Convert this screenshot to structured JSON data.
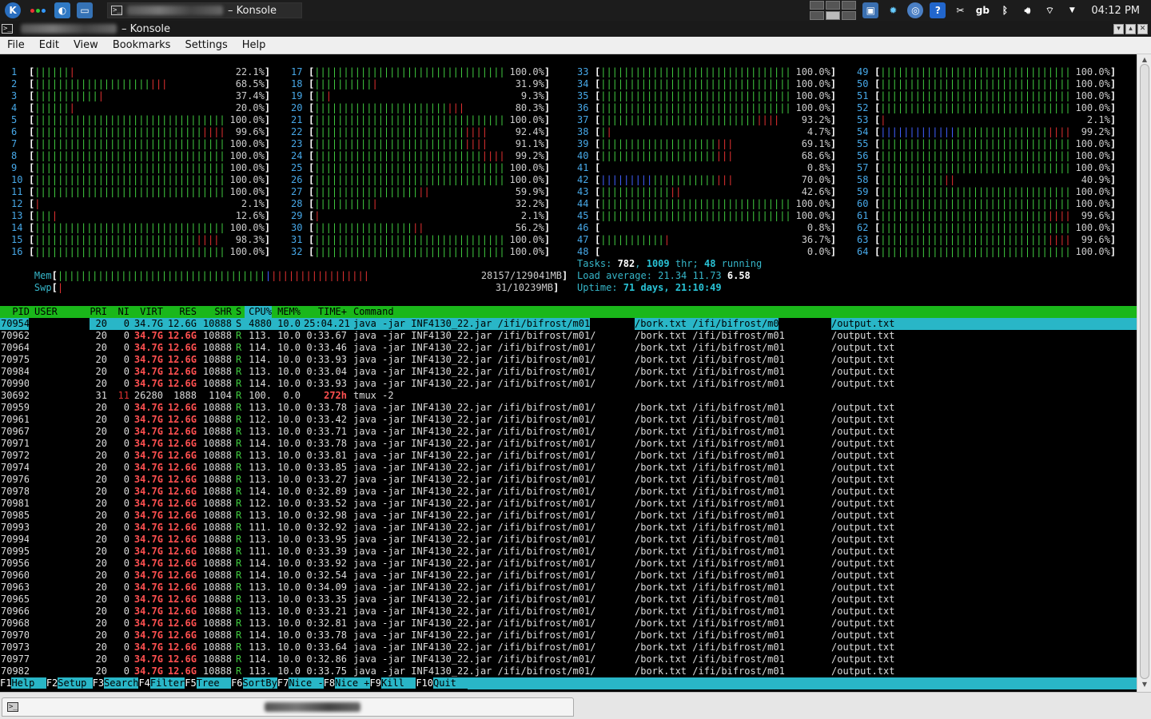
{
  "panel": {
    "task_title": "– Konsole",
    "clock": "04:12 PM",
    "tray_gb": "gb",
    "tray_help": "?"
  },
  "window": {
    "title": "– Konsole"
  },
  "menu": [
    "File",
    "Edit",
    "View",
    "Bookmarks",
    "Settings",
    "Help"
  ],
  "cpus": [
    {
      "n": "1",
      "pct": 22.1,
      "label": "22.1%"
    },
    {
      "n": "2",
      "pct": 68.5,
      "label": "68.5%"
    },
    {
      "n": "3",
      "pct": 37.4,
      "label": "37.4%"
    },
    {
      "n": "4",
      "pct": 20.0,
      "label": "20.0%"
    },
    {
      "n": "5",
      "pct": 100.0,
      "label": "100.0%"
    },
    {
      "n": "6",
      "pct": 99.6,
      "label": "99.6%"
    },
    {
      "n": "7",
      "pct": 100.0,
      "label": "100.0%"
    },
    {
      "n": "8",
      "pct": 100.0,
      "label": "100.0%"
    },
    {
      "n": "9",
      "pct": 100.0,
      "label": "100.0%"
    },
    {
      "n": "10",
      "pct": 100.0,
      "label": "100.0%"
    },
    {
      "n": "11",
      "pct": 100.0,
      "label": "100.0%"
    },
    {
      "n": "12",
      "pct": 2.1,
      "label": "2.1%"
    },
    {
      "n": "13",
      "pct": 12.6,
      "label": "12.6%"
    },
    {
      "n": "14",
      "pct": 100.0,
      "label": "100.0%"
    },
    {
      "n": "15",
      "pct": 98.3,
      "label": "98.3%"
    },
    {
      "n": "16",
      "pct": 100.0,
      "label": "100.0%"
    },
    {
      "n": "17",
      "pct": 100.0,
      "label": "100.0%"
    },
    {
      "n": "18",
      "pct": 31.9,
      "label": "31.9%"
    },
    {
      "n": "19",
      "pct": 9.3,
      "label": "9.3%"
    },
    {
      "n": "20",
      "pct": 80.3,
      "label": "80.3%"
    },
    {
      "n": "21",
      "pct": 100.0,
      "label": "100.0%"
    },
    {
      "n": "22",
      "pct": 92.4,
      "label": "92.4%"
    },
    {
      "n": "23",
      "pct": 91.1,
      "label": "91.1%"
    },
    {
      "n": "24",
      "pct": 99.2,
      "label": "99.2%"
    },
    {
      "n": "25",
      "pct": 100.0,
      "label": "100.0%"
    },
    {
      "n": "26",
      "pct": 100.0,
      "label": "100.0%"
    },
    {
      "n": "27",
      "pct": 59.9,
      "label": "59.9%"
    },
    {
      "n": "28",
      "pct": 32.2,
      "label": "32.2%"
    },
    {
      "n": "29",
      "pct": 2.1,
      "label": "2.1%"
    },
    {
      "n": "30",
      "pct": 56.2,
      "label": "56.2%"
    },
    {
      "n": "31",
      "pct": 100.0,
      "label": "100.0%"
    },
    {
      "n": "32",
      "pct": 100.0,
      "label": "100.0%"
    },
    {
      "n": "33",
      "pct": 100.0,
      "label": "100.0%"
    },
    {
      "n": "34",
      "pct": 100.0,
      "label": "100.0%"
    },
    {
      "n": "35",
      "pct": 100.0,
      "label": "100.0%"
    },
    {
      "n": "36",
      "pct": 100.0,
      "label": "100.0%"
    },
    {
      "n": "37",
      "pct": 93.2,
      "label": "93.2%"
    },
    {
      "n": "38",
      "pct": 4.7,
      "label": "4.7%"
    },
    {
      "n": "39",
      "pct": 69.1,
      "label": "69.1%"
    },
    {
      "n": "40",
      "pct": 68.6,
      "label": "68.6%"
    },
    {
      "n": "41",
      "pct": 0.8,
      "label": "0.8%"
    },
    {
      "n": "42",
      "pct": 70.0,
      "label": "70.0%"
    },
    {
      "n": "43",
      "pct": 42.6,
      "label": "42.6%"
    },
    {
      "n": "44",
      "pct": 100.0,
      "label": "100.0%"
    },
    {
      "n": "45",
      "pct": 100.0,
      "label": "100.0%"
    },
    {
      "n": "46",
      "pct": 0.8,
      "label": "0.8%"
    },
    {
      "n": "47",
      "pct": 36.7,
      "label": "36.7%"
    },
    {
      "n": "48",
      "pct": 0.0,
      "label": "0.0%"
    },
    {
      "n": "49",
      "pct": 100.0,
      "label": "100.0%"
    },
    {
      "n": "50",
      "pct": 100.0,
      "label": "100.0%"
    },
    {
      "n": "51",
      "pct": 100.0,
      "label": "100.0%"
    },
    {
      "n": "52",
      "pct": 100.0,
      "label": "100.0%"
    },
    {
      "n": "53",
      "pct": 2.1,
      "label": "2.1%"
    },
    {
      "n": "54",
      "pct": 99.2,
      "label": "99.2%"
    },
    {
      "n": "55",
      "pct": 100.0,
      "label": "100.0%"
    },
    {
      "n": "56",
      "pct": 100.0,
      "label": "100.0%"
    },
    {
      "n": "57",
      "pct": 100.0,
      "label": "100.0%"
    },
    {
      "n": "58",
      "pct": 40.9,
      "label": "40.9%"
    },
    {
      "n": "59",
      "pct": 100.0,
      "label": "100.0%"
    },
    {
      "n": "60",
      "pct": 100.0,
      "label": "100.0%"
    },
    {
      "n": "61",
      "pct": 99.6,
      "label": "99.6%"
    },
    {
      "n": "62",
      "pct": 100.0,
      "label": "100.0%"
    },
    {
      "n": "63",
      "pct": 99.6,
      "label": "99.6%"
    },
    {
      "n": "64",
      "pct": 100.0,
      "label": "100.0%"
    }
  ],
  "mem": {
    "label": "Mem",
    "text": "28157/129041MB",
    "pct": 21.8
  },
  "swp": {
    "label": "Swp",
    "text": "31/10239MB",
    "pct": 0.3
  },
  "tasks": {
    "prefix": "Tasks: ",
    "count": "782",
    "sep1": ", ",
    "thr": "1009",
    "thr_lbl": " thr; ",
    "running": "48",
    "running_lbl": " running"
  },
  "load": {
    "prefix": "Load average: ",
    "l1": "21.34",
    "l5": "11.73",
    "l15": "6.58"
  },
  "uptime": {
    "prefix": "Uptime: ",
    "value": "71 days, 21:10:49"
  },
  "table": {
    "headers": {
      "pid": "PID",
      "user": "USER",
      "pri": "PRI",
      "ni": "NI",
      "virt": "VIRT",
      "res": "RES",
      "shr": "SHR",
      "s": "S",
      "cpu": "CPU%",
      "mem": "MEM%",
      "time": "TIME+",
      "cmd": "Command"
    },
    "rows": [
      {
        "pid": "70954",
        "pri": "20",
        "ni": "0",
        "virt": "34.7G",
        "res": "12.6G",
        "shr": "10888",
        "s": "S",
        "cpu": "4880",
        "mem": "10.0",
        "time": "25:04.21",
        "c1": "java -jar INF4130_22.jar /ifi/bifrost/m01/",
        "c2": "/bork.txt /ifi/bifrost/m01",
        "c3": "/output.txt",
        "sel": true
      },
      {
        "pid": "70962",
        "pri": "20",
        "ni": "0",
        "virt": "34.7G",
        "res": "12.6G",
        "shr": "10888",
        "s": "R",
        "cpu": "113.",
        "mem": "10.0",
        "time": "0:33.67",
        "c1": "java -jar INF4130_22.jar /ifi/bifrost/m01/",
        "c2": "/bork.txt /ifi/bifrost/m01",
        "c3": "/output.txt"
      },
      {
        "pid": "70964",
        "pri": "20",
        "ni": "0",
        "virt": "34.7G",
        "res": "12.6G",
        "shr": "10888",
        "s": "R",
        "cpu": "114.",
        "mem": "10.0",
        "time": "0:33.46",
        "c1": "java -jar INF4130_22.jar /ifi/bifrost/m01/",
        "c2": "/bork.txt /ifi/bifrost/m01",
        "c3": "/output.txt"
      },
      {
        "pid": "70975",
        "pri": "20",
        "ni": "0",
        "virt": "34.7G",
        "res": "12.6G",
        "shr": "10888",
        "s": "R",
        "cpu": "114.",
        "mem": "10.0",
        "time": "0:33.93",
        "c1": "java -jar INF4130_22.jar /ifi/bifrost/m01/",
        "c2": "/bork.txt /ifi/bifrost/m01",
        "c3": "/output.txt"
      },
      {
        "pid": "70984",
        "pri": "20",
        "ni": "0",
        "virt": "34.7G",
        "res": "12.6G",
        "shr": "10888",
        "s": "R",
        "cpu": "113.",
        "mem": "10.0",
        "time": "0:33.04",
        "c1": "java -jar INF4130_22.jar /ifi/bifrost/m01/",
        "c2": "/bork.txt /ifi/bifrost/m01",
        "c3": "/output.txt"
      },
      {
        "pid": "70990",
        "pri": "20",
        "ni": "0",
        "virt": "34.7G",
        "res": "12.6G",
        "shr": "10888",
        "s": "R",
        "cpu": "114.",
        "mem": "10.0",
        "time": "0:33.93",
        "c1": "java -jar INF4130_22.jar /ifi/bifrost/m01/",
        "c2": "/bork.txt /ifi/bifrost/m01",
        "c3": "/output.txt"
      },
      {
        "pid": "30692",
        "pri": "31",
        "ni": "11",
        "virt": "26280",
        "res": "1888",
        "shr": "1104",
        "s": "R",
        "cpu": "100.",
        "mem": "0.0",
        "time": "272h",
        "c1": "tmux -2",
        "c2": "",
        "c3": "",
        "tmux": true
      },
      {
        "pid": "70959",
        "pri": "20",
        "ni": "0",
        "virt": "34.7G",
        "res": "12.6G",
        "shr": "10888",
        "s": "R",
        "cpu": "113.",
        "mem": "10.0",
        "time": "0:33.78",
        "c1": "java -jar INF4130_22.jar /ifi/bifrost/m01/",
        "c2": "/bork.txt /ifi/bifrost/m01",
        "c3": "/output.txt"
      },
      {
        "pid": "70961",
        "pri": "20",
        "ni": "0",
        "virt": "34.7G",
        "res": "12.6G",
        "shr": "10888",
        "s": "R",
        "cpu": "112.",
        "mem": "10.0",
        "time": "0:33.42",
        "c1": "java -jar INF4130_22.jar /ifi/bifrost/m01/",
        "c2": "/bork.txt /ifi/bifrost/m01",
        "c3": "/output.txt"
      },
      {
        "pid": "70967",
        "pri": "20",
        "ni": "0",
        "virt": "34.7G",
        "res": "12.6G",
        "shr": "10888",
        "s": "R",
        "cpu": "113.",
        "mem": "10.0",
        "time": "0:33.71",
        "c1": "java -jar INF4130_22.jar /ifi/bifrost/m01/",
        "c2": "/bork.txt /ifi/bifrost/m01",
        "c3": "/output.txt"
      },
      {
        "pid": "70971",
        "pri": "20",
        "ni": "0",
        "virt": "34.7G",
        "res": "12.6G",
        "shr": "10888",
        "s": "R",
        "cpu": "114.",
        "mem": "10.0",
        "time": "0:33.78",
        "c1": "java -jar INF4130_22.jar /ifi/bifrost/m01/",
        "c2": "/bork.txt /ifi/bifrost/m01",
        "c3": "/output.txt"
      },
      {
        "pid": "70972",
        "pri": "20",
        "ni": "0",
        "virt": "34.7G",
        "res": "12.6G",
        "shr": "10888",
        "s": "R",
        "cpu": "113.",
        "mem": "10.0",
        "time": "0:33.81",
        "c1": "java -jar INF4130_22.jar /ifi/bifrost/m01/",
        "c2": "/bork.txt /ifi/bifrost/m01",
        "c3": "/output.txt"
      },
      {
        "pid": "70974",
        "pri": "20",
        "ni": "0",
        "virt": "34.7G",
        "res": "12.6G",
        "shr": "10888",
        "s": "R",
        "cpu": "113.",
        "mem": "10.0",
        "time": "0:33.85",
        "c1": "java -jar INF4130_22.jar /ifi/bifrost/m01/",
        "c2": "/bork.txt /ifi/bifrost/m01",
        "c3": "/output.txt"
      },
      {
        "pid": "70976",
        "pri": "20",
        "ni": "0",
        "virt": "34.7G",
        "res": "12.6G",
        "shr": "10888",
        "s": "R",
        "cpu": "113.",
        "mem": "10.0",
        "time": "0:33.27",
        "c1": "java -jar INF4130_22.jar /ifi/bifrost/m01/",
        "c2": "/bork.txt /ifi/bifrost/m01",
        "c3": "/output.txt"
      },
      {
        "pid": "70978",
        "pri": "20",
        "ni": "0",
        "virt": "34.7G",
        "res": "12.6G",
        "shr": "10888",
        "s": "R",
        "cpu": "114.",
        "mem": "10.0",
        "time": "0:32.89",
        "c1": "java -jar INF4130_22.jar /ifi/bifrost/m01/",
        "c2": "/bork.txt /ifi/bifrost/m01",
        "c3": "/output.txt"
      },
      {
        "pid": "70981",
        "pri": "20",
        "ni": "0",
        "virt": "34.7G",
        "res": "12.6G",
        "shr": "10888",
        "s": "R",
        "cpu": "112.",
        "mem": "10.0",
        "time": "0:33.52",
        "c1": "java -jar INF4130_22.jar /ifi/bifrost/m01/",
        "c2": "/bork.txt /ifi/bifrost/m01",
        "c3": "/output.txt"
      },
      {
        "pid": "70985",
        "pri": "20",
        "ni": "0",
        "virt": "34.7G",
        "res": "12.6G",
        "shr": "10888",
        "s": "R",
        "cpu": "113.",
        "mem": "10.0",
        "time": "0:32.98",
        "c1": "java -jar INF4130_22.jar /ifi/bifrost/m01/",
        "c2": "/bork.txt /ifi/bifrost/m01",
        "c3": "/output.txt"
      },
      {
        "pid": "70993",
        "pri": "20",
        "ni": "0",
        "virt": "34.7G",
        "res": "12.6G",
        "shr": "10888",
        "s": "R",
        "cpu": "111.",
        "mem": "10.0",
        "time": "0:32.92",
        "c1": "java -jar INF4130_22.jar /ifi/bifrost/m01/",
        "c2": "/bork.txt /ifi/bifrost/m01",
        "c3": "/output.txt"
      },
      {
        "pid": "70994",
        "pri": "20",
        "ni": "0",
        "virt": "34.7G",
        "res": "12.6G",
        "shr": "10888",
        "s": "R",
        "cpu": "113.",
        "mem": "10.0",
        "time": "0:33.95",
        "c1": "java -jar INF4130_22.jar /ifi/bifrost/m01/",
        "c2": "/bork.txt /ifi/bifrost/m01",
        "c3": "/output.txt"
      },
      {
        "pid": "70995",
        "pri": "20",
        "ni": "0",
        "virt": "34.7G",
        "res": "12.6G",
        "shr": "10888",
        "s": "R",
        "cpu": "111.",
        "mem": "10.0",
        "time": "0:33.39",
        "c1": "java -jar INF4130_22.jar /ifi/bifrost/m01/",
        "c2": "/bork.txt /ifi/bifrost/m01",
        "c3": "/output.txt"
      },
      {
        "pid": "70956",
        "pri": "20",
        "ni": "0",
        "virt": "34.7G",
        "res": "12.6G",
        "shr": "10888",
        "s": "R",
        "cpu": "114.",
        "mem": "10.0",
        "time": "0:33.92",
        "c1": "java -jar INF4130_22.jar /ifi/bifrost/m01/",
        "c2": "/bork.txt /ifi/bifrost/m01",
        "c3": "/output.txt"
      },
      {
        "pid": "70960",
        "pri": "20",
        "ni": "0",
        "virt": "34.7G",
        "res": "12.6G",
        "shr": "10888",
        "s": "R",
        "cpu": "114.",
        "mem": "10.0",
        "time": "0:32.54",
        "c1": "java -jar INF4130_22.jar /ifi/bifrost/m01/",
        "c2": "/bork.txt /ifi/bifrost/m01",
        "c3": "/output.txt"
      },
      {
        "pid": "70963",
        "pri": "20",
        "ni": "0",
        "virt": "34.7G",
        "res": "12.6G",
        "shr": "10888",
        "s": "R",
        "cpu": "113.",
        "mem": "10.0",
        "time": "0:34.09",
        "c1": "java -jar INF4130_22.jar /ifi/bifrost/m01/",
        "c2": "/bork.txt /ifi/bifrost/m01",
        "c3": "/output.txt"
      },
      {
        "pid": "70965",
        "pri": "20",
        "ni": "0",
        "virt": "34.7G",
        "res": "12.6G",
        "shr": "10888",
        "s": "R",
        "cpu": "113.",
        "mem": "10.0",
        "time": "0:33.35",
        "c1": "java -jar INF4130_22.jar /ifi/bifrost/m01/",
        "c2": "/bork.txt /ifi/bifrost/m01",
        "c3": "/output.txt"
      },
      {
        "pid": "70966",
        "pri": "20",
        "ni": "0",
        "virt": "34.7G",
        "res": "12.6G",
        "shr": "10888",
        "s": "R",
        "cpu": "113.",
        "mem": "10.0",
        "time": "0:33.21",
        "c1": "java -jar INF4130_22.jar /ifi/bifrost/m01/",
        "c2": "/bork.txt /ifi/bifrost/m01",
        "c3": "/output.txt"
      },
      {
        "pid": "70968",
        "pri": "20",
        "ni": "0",
        "virt": "34.7G",
        "res": "12.6G",
        "shr": "10888",
        "s": "R",
        "cpu": "113.",
        "mem": "10.0",
        "time": "0:32.81",
        "c1": "java -jar INF4130_22.jar /ifi/bifrost/m01/",
        "c2": "/bork.txt /ifi/bifrost/m01",
        "c3": "/output.txt"
      },
      {
        "pid": "70970",
        "pri": "20",
        "ni": "0",
        "virt": "34.7G",
        "res": "12.6G",
        "shr": "10888",
        "s": "R",
        "cpu": "114.",
        "mem": "10.0",
        "time": "0:33.78",
        "c1": "java -jar INF4130_22.jar /ifi/bifrost/m01/",
        "c2": "/bork.txt /ifi/bifrost/m01",
        "c3": "/output.txt"
      },
      {
        "pid": "70973",
        "pri": "20",
        "ni": "0",
        "virt": "34.7G",
        "res": "12.6G",
        "shr": "10888",
        "s": "R",
        "cpu": "113.",
        "mem": "10.0",
        "time": "0:33.64",
        "c1": "java -jar INF4130_22.jar /ifi/bifrost/m01/",
        "c2": "/bork.txt /ifi/bifrost/m01",
        "c3": "/output.txt"
      },
      {
        "pid": "70977",
        "pri": "20",
        "ni": "0",
        "virt": "34.7G",
        "res": "12.6G",
        "shr": "10888",
        "s": "R",
        "cpu": "114.",
        "mem": "10.0",
        "time": "0:32.86",
        "c1": "java -jar INF4130_22.jar /ifi/bifrost/m01/",
        "c2": "/bork.txt /ifi/bifrost/m01",
        "c3": "/output.txt"
      },
      {
        "pid": "70982",
        "pri": "20",
        "ni": "0",
        "virt": "34.7G",
        "res": "12.6G",
        "shr": "10888",
        "s": "R",
        "cpu": "113.",
        "mem": "10.0",
        "time": "0:33.75",
        "c1": "java -jar INF4130_22.jar /ifi/bifrost/m01/",
        "c2": "/bork.txt /ifi/bifrost/m01",
        "c3": "/output.txt"
      }
    ]
  },
  "fkeys": [
    {
      "key": "F1",
      "name": "Help  "
    },
    {
      "key": "F2",
      "name": "Setup "
    },
    {
      "key": "F3",
      "name": "Search"
    },
    {
      "key": "F4",
      "name": "Filter"
    },
    {
      "key": "F5",
      "name": "Tree  "
    },
    {
      "key": "F6",
      "name": "SortBy"
    },
    {
      "key": "F7",
      "name": "Nice -"
    },
    {
      "key": "F8",
      "name": "Nice +"
    },
    {
      "key": "F9",
      "name": "Kill  "
    },
    {
      "key": "F10",
      "name": "Quit  "
    }
  ],
  "colors": {
    "header_green": "#1ab71a",
    "highlight_cyan": "#29b6c7",
    "bar_green": "#3fc83f",
    "bar_red": "#e03030",
    "bar_blue": "#4060ff"
  }
}
